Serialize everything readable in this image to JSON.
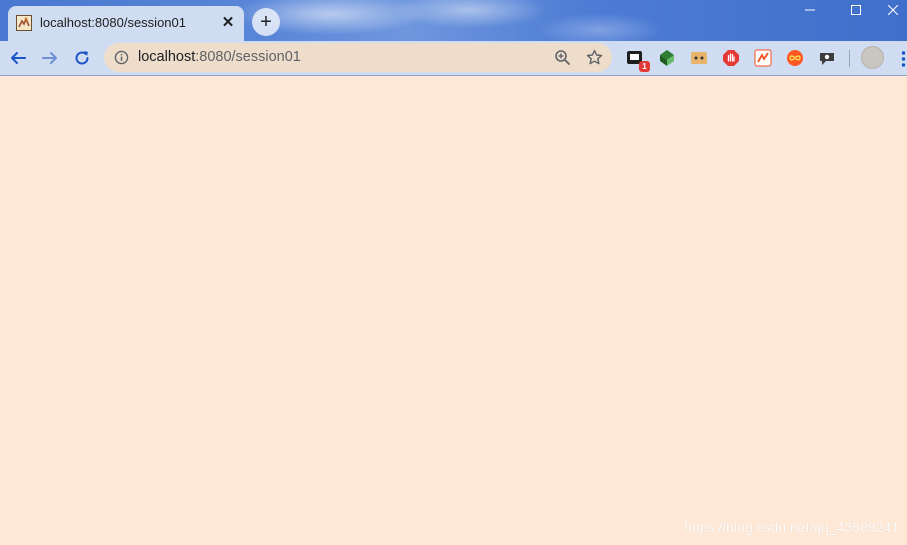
{
  "tab": {
    "title": "localhost:8080/session01",
    "close_symbol": "✕",
    "favicon": "tomcat-favicon-icon"
  },
  "new_tab": {
    "symbol": "+"
  },
  "window_controls": {
    "minimize": "—",
    "maximize": "☐",
    "close": "✕"
  },
  "address_bar": {
    "host": "localhost",
    "path": ":8080/session01"
  },
  "extensions": [
    {
      "name": "extension-1-icon",
      "badge": "1"
    },
    {
      "name": "extension-2-icon"
    },
    {
      "name": "extension-3-icon"
    },
    {
      "name": "adblock-icon"
    },
    {
      "name": "extension-5-icon"
    },
    {
      "name": "extension-6-icon"
    },
    {
      "name": "extension-7-icon"
    }
  ],
  "page": {
    "background": "#FFE8D6",
    "watermark": "https://blog.csdn.net/qq_43589241"
  },
  "colors": {
    "toolbar": "#CFDCF1",
    "omnibox": "#EEDDCB",
    "accent": "#1A73E8"
  }
}
